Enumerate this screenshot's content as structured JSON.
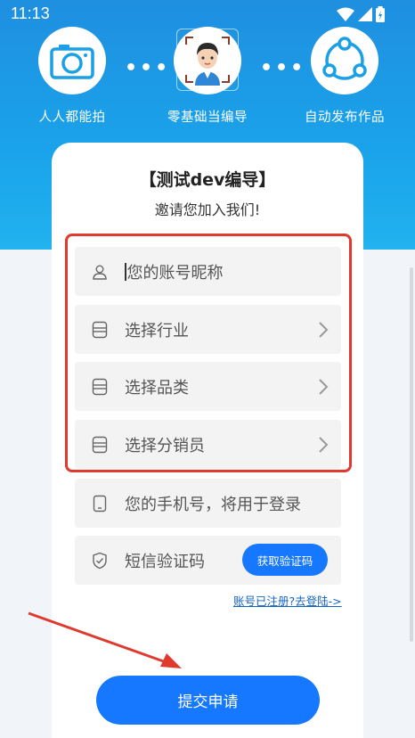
{
  "status_bar": {
    "time": "11:13"
  },
  "steps": [
    {
      "label": "人人都能拍",
      "icon": "camera-icon"
    },
    {
      "label": "零基础当编导",
      "icon": "avatar-face-icon"
    },
    {
      "label": "自动发布作品",
      "icon": "share-icon"
    }
  ],
  "step_separator": "•••",
  "header": {
    "title": "【测试dev编导】",
    "subtitle": "邀请您加入我们!"
  },
  "form": {
    "nickname_placeholder": "您的账号昵称",
    "industry_label": "选择行业",
    "category_label": "选择品类",
    "distributor_label": "选择分销员",
    "phone_placeholder": "您的手机号，将用于登录",
    "sms_placeholder": "短信验证码",
    "get_code_label": "获取验证码",
    "login_link": "账号已注册?去登陆->",
    "submit_label": "提交申请"
  },
  "colors": {
    "primary": "#1677ff",
    "hero": "#1a9be6",
    "annotation_red": "#e03a2f"
  }
}
